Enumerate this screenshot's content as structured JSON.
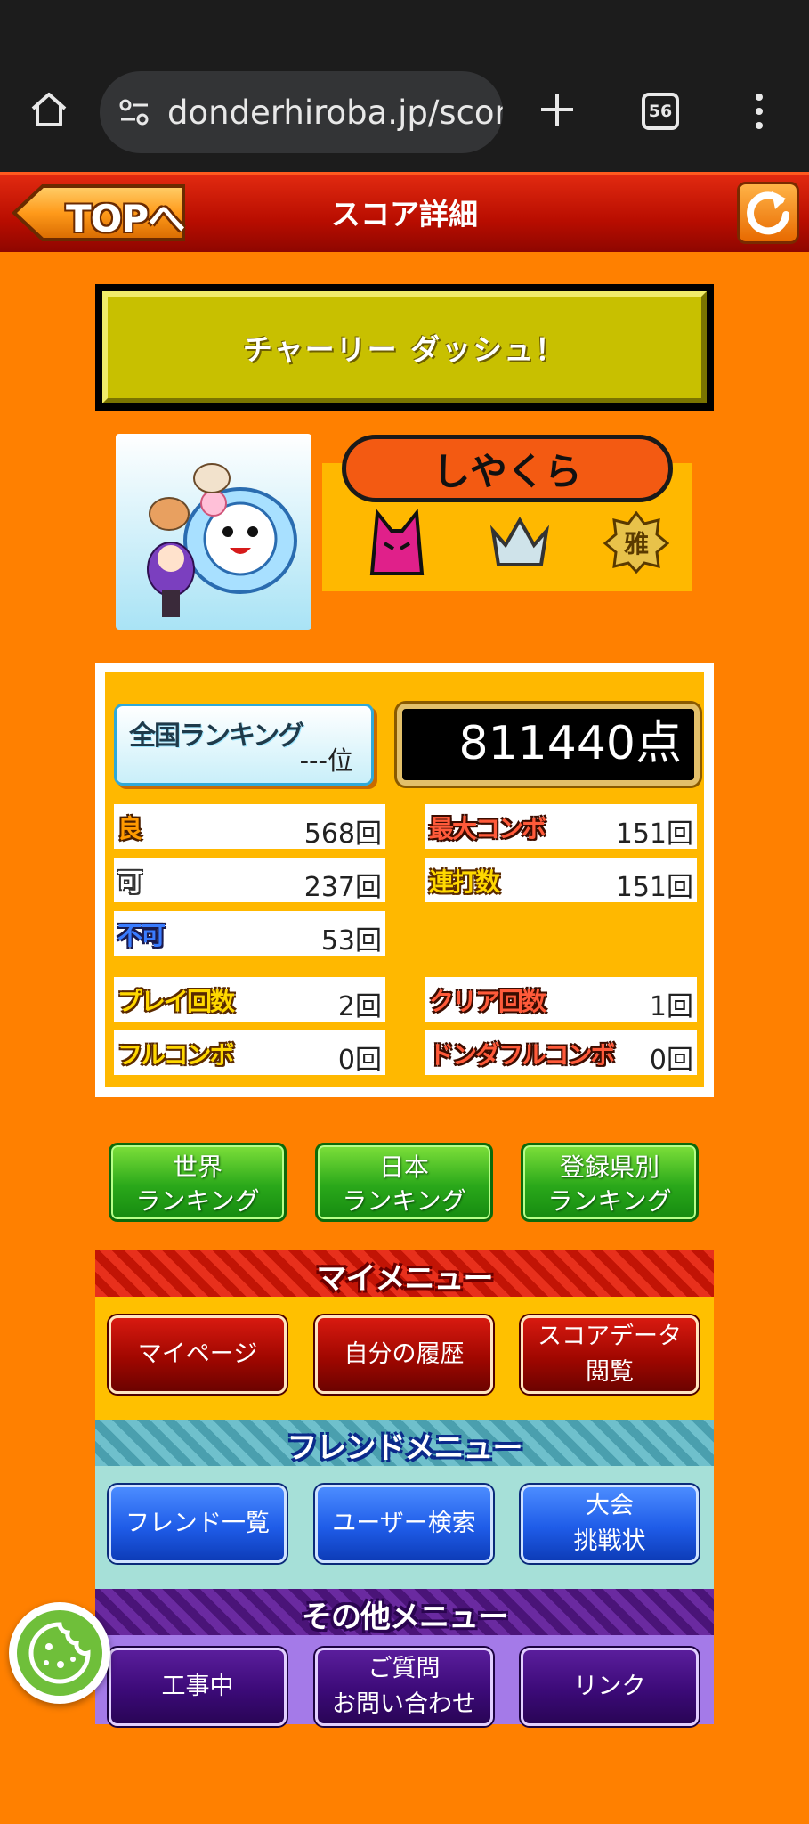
{
  "browser": {
    "url": "donderhiroba.jp/score",
    "tab_count": "56"
  },
  "header": {
    "top_label": "TOPへ",
    "title": "スコア詳細"
  },
  "song": {
    "title": "チャーリー ダッシュ！"
  },
  "player": {
    "name": "しやくら",
    "badges": [
      "oni-difficulty-icon",
      "crown-icon",
      "miyabi-rank-icon"
    ]
  },
  "score": {
    "ranking_label": "全国ランキング",
    "ranking_value": "---位",
    "points": "811440点",
    "good_label": "良",
    "good": "568回",
    "ok_label": "可",
    "ok": "237回",
    "bad_label": "不可",
    "bad": "53回",
    "max_combo_label": "最大コンボ",
    "max_combo": "151回",
    "drumroll_label": "連打数",
    "drumroll": "151回",
    "play_count_label": "プレイ回数",
    "play_count": "2回",
    "clear_count_label": "クリア回数",
    "clear_count": "1回",
    "full_combo_label": "フルコンボ",
    "full_combo": "0回",
    "donderful_combo_label": "ドンダフルコンボ",
    "donderful_combo": "0回"
  },
  "ranking_buttons": {
    "world_1": "世界",
    "world_2": "ランキング",
    "japan_1": "日本",
    "japan_2": "ランキング",
    "pref_1": "登録県別",
    "pref_2": "ランキング"
  },
  "my_menu": {
    "title": "マイメニュー",
    "mypage": "マイページ",
    "history": "自分の履歴",
    "scoredata_1": "スコアデータ",
    "scoredata_2": "閲覧"
  },
  "friend_menu": {
    "title": "フレンドメニュー",
    "friend_list": "フレンド一覧",
    "user_search": "ユーザー検索",
    "tournament_1": "大会",
    "tournament_2": "挑戦状"
  },
  "other_menu": {
    "title": "その他メニュー",
    "construction": "工事中",
    "inquiry_1": "ご質問",
    "inquiry_2": "お問い合わせ",
    "links": "リンク"
  },
  "colors": {
    "page_bg": "#ff8000",
    "header_red": "#b80d00",
    "panel_yellow": "#ffb800",
    "song_olive": "#c8c000"
  }
}
